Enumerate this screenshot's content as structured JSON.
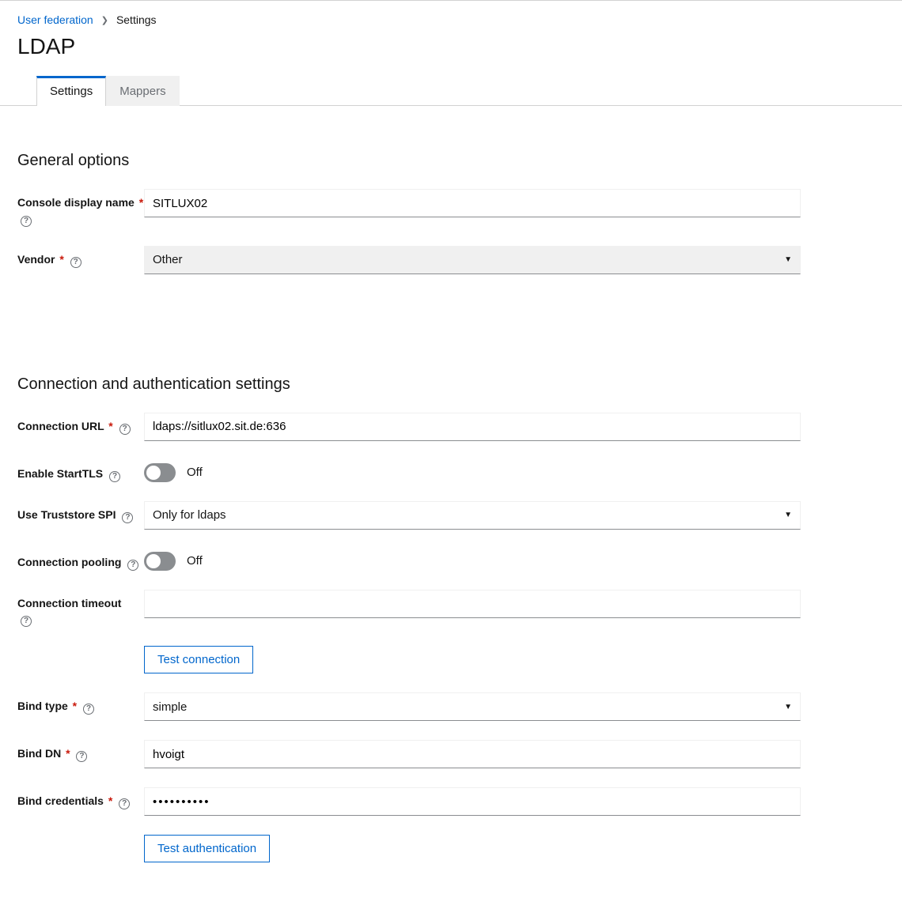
{
  "breadcrumb": {
    "parent": "User federation",
    "current": "Settings"
  },
  "page_title": "LDAP",
  "tabs": {
    "settings": "Settings",
    "mappers": "Mappers"
  },
  "sections": {
    "general": {
      "title": "General options",
      "console_display_name": {
        "label": "Console display name",
        "value": "SITLUX02"
      },
      "vendor": {
        "label": "Vendor",
        "value": "Other"
      }
    },
    "connection": {
      "title": "Connection and authentication settings",
      "connection_url": {
        "label": "Connection URL",
        "value": "ldaps://sitlux02.sit.de:636"
      },
      "enable_starttls": {
        "label": "Enable StartTLS",
        "state": "Off"
      },
      "truststore": {
        "label": "Use Truststore SPI",
        "value": "Only for ldaps"
      },
      "connection_pooling": {
        "label": "Connection pooling",
        "state": "Off"
      },
      "connection_timeout": {
        "label": "Connection timeout",
        "value": ""
      },
      "test_connection_btn": "Test connection",
      "bind_type": {
        "label": "Bind type",
        "value": "simple"
      },
      "bind_dn": {
        "label": "Bind DN",
        "value": "hvoigt"
      },
      "bind_credentials": {
        "label": "Bind credentials",
        "value": "••••••••••"
      },
      "test_auth_btn": "Test authentication"
    }
  }
}
